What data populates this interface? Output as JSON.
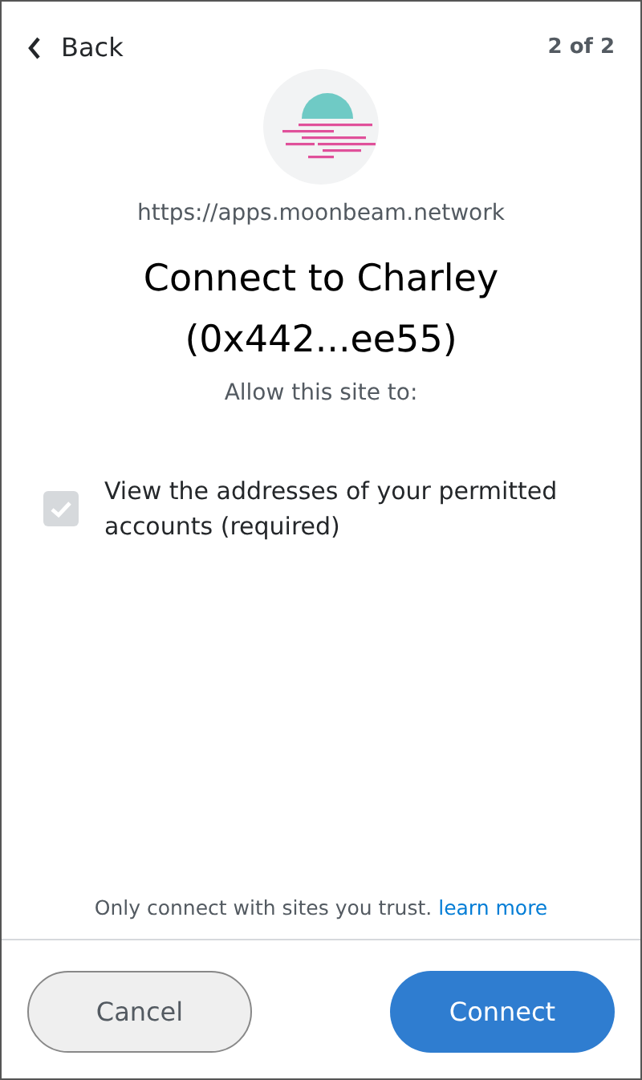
{
  "header": {
    "back_label": "Back",
    "page_indicator": "2 of 2"
  },
  "site": {
    "url": "https://apps.moonbeam.network"
  },
  "title": {
    "line_1": "Connect to Charley",
    "line_2": "(0x442...ee55)"
  },
  "subtitle": "Allow this site to:",
  "permissions": [
    {
      "label": "View the addresses of your permitted accounts (required)",
      "checked": true,
      "disabled": true
    }
  ],
  "footer_note": {
    "text": "Only connect with sites you trust.",
    "link": "learn more"
  },
  "buttons": [
    {
      "label": "Cancel",
      "kind": "secondary"
    },
    {
      "label": "Connect",
      "kind": "primary"
    }
  ]
}
